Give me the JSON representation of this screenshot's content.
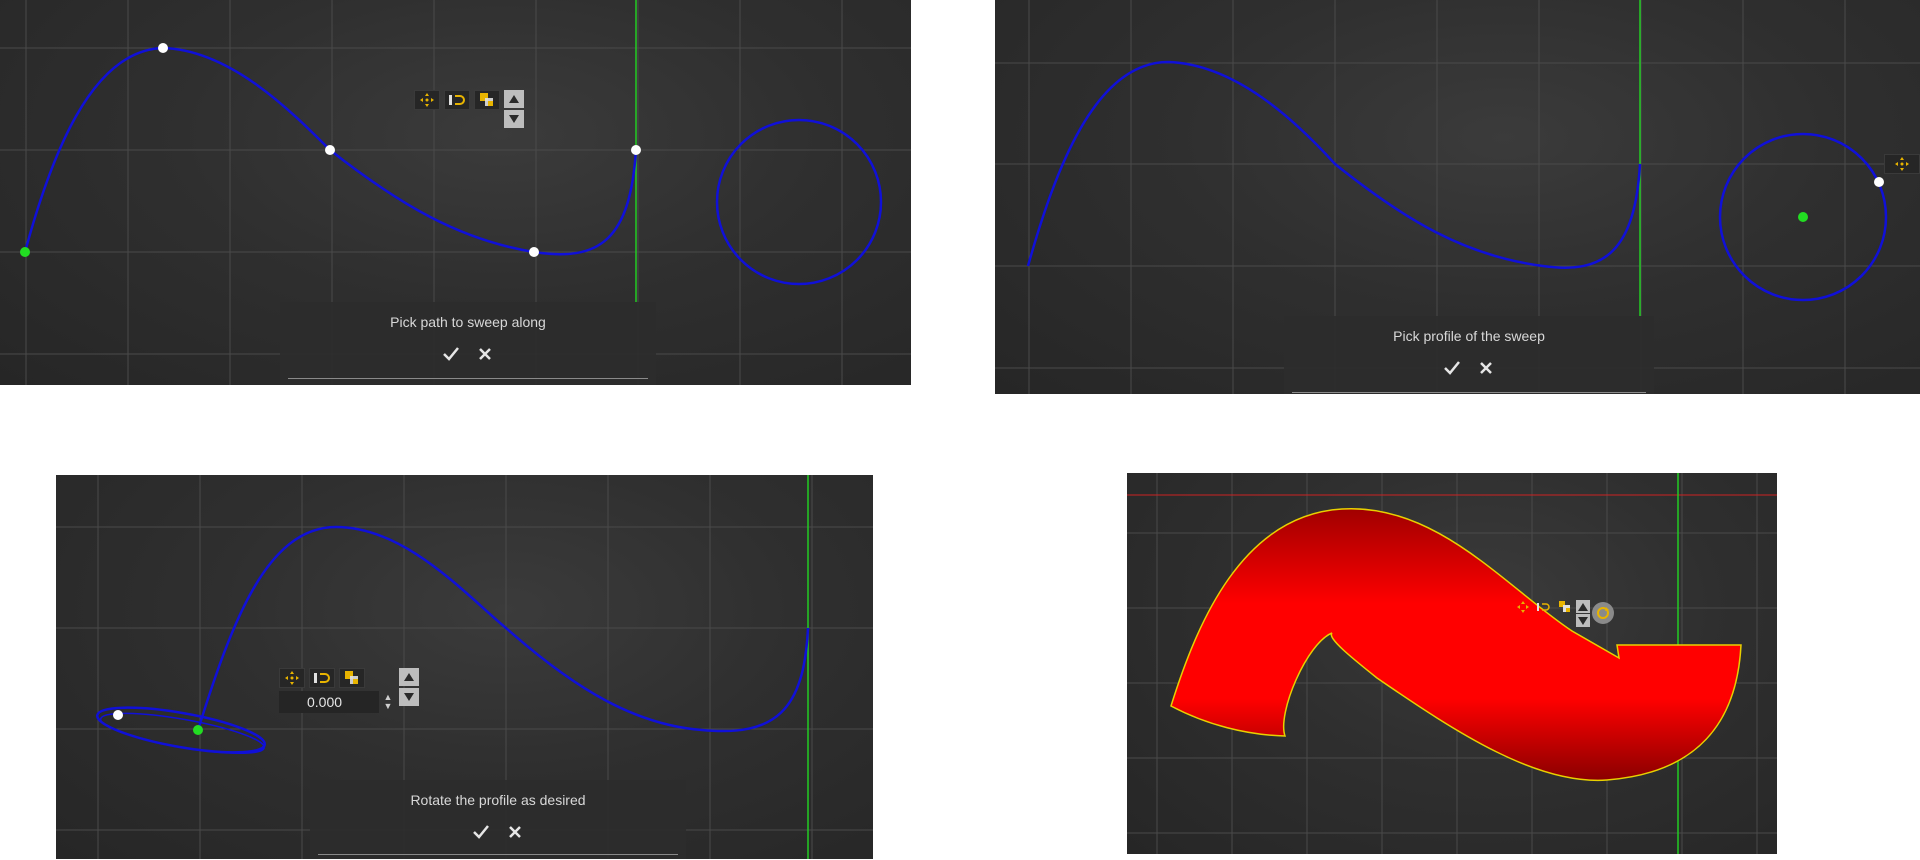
{
  "panels": [
    {
      "id": "path-step",
      "prompt": "Pick path to sweep along"
    },
    {
      "id": "profile-step",
      "prompt": "Pick profile of the sweep"
    },
    {
      "id": "rotate-step",
      "prompt": "Rotate the profile as desired",
      "rotation_value": "0.000"
    },
    {
      "id": "result-step"
    }
  ],
  "colors": {
    "background": "#2d2d2d",
    "grid": "#4a4a4a",
    "curve": "#1010d8",
    "axis_green": "#22cc22",
    "axis_red": "#cc2222",
    "point_white": "#ffffff",
    "point_green": "#22dd22",
    "sweep_fill": "#ff0000",
    "sweep_outline": "#e8d000",
    "toolbar_accent": "#e8b400"
  },
  "icons": {
    "confirm": "check-icon",
    "cancel": "close-icon",
    "move": "move-gizmo-icon",
    "snap": "magnet-snap-icon",
    "layers": "copy-layers-icon",
    "up": "arrow-up-icon",
    "down": "arrow-down-icon"
  }
}
